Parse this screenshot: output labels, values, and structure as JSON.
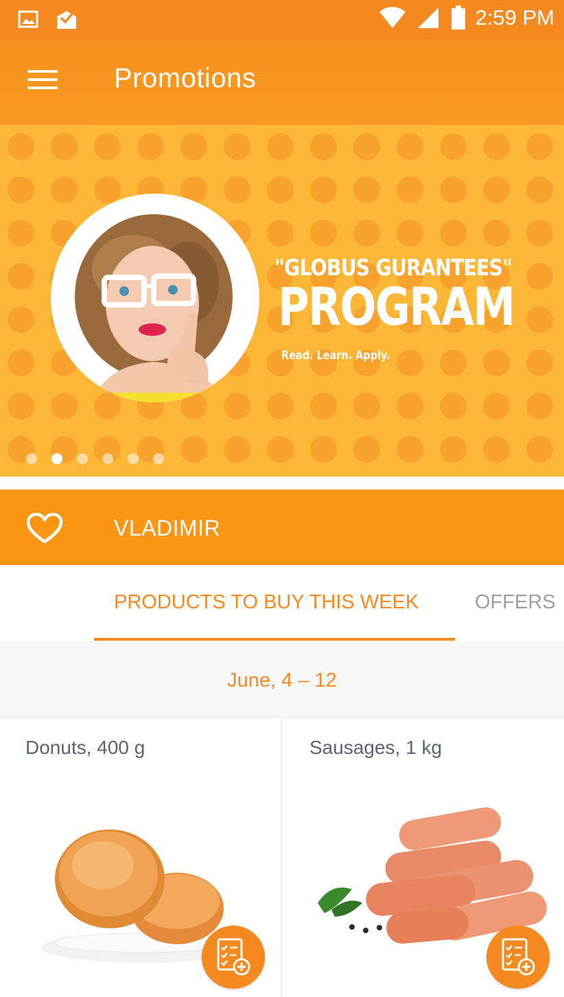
{
  "status_bar": {
    "time": "2:59 PM",
    "left_icons": [
      "image-icon",
      "mail-check-icon"
    ],
    "right_icons": [
      "wifi-icon",
      "signal-icon",
      "battery-icon"
    ]
  },
  "app_bar": {
    "title": "Promotions",
    "menu_icon": "hamburger-menu-icon"
  },
  "banner": {
    "line1": "\"GLOBUS GURANTEES\"",
    "line2": "PROGRAM",
    "line3": "Read. Learn. Apply.",
    "dots_total": 6,
    "active_dot": 2
  },
  "store": {
    "name": "VLADIMIR",
    "icon": "heart-outline-icon"
  },
  "tabs": [
    {
      "label": "PRODUCTS TO BUY THIS WEEK",
      "active": true
    },
    {
      "label": "OFFERS",
      "active": false
    }
  ],
  "date_range": "June, 4 – 12",
  "products": [
    {
      "name": "Donuts, 400 g",
      "image": "donuts-photo",
      "action_icon": "add-to-list-icon"
    },
    {
      "name": "Sausages, 1 kg",
      "image": "sausages-photo",
      "action_icon": "add-to-list-icon"
    }
  ],
  "colors": {
    "primary": "#f6891f",
    "banner_bg": "#fdb737",
    "banner_dots": "#f7a22d",
    "store_bar": "#fb9514",
    "text_muted": "#9e9e9e",
    "text_product": "#5c6473"
  }
}
